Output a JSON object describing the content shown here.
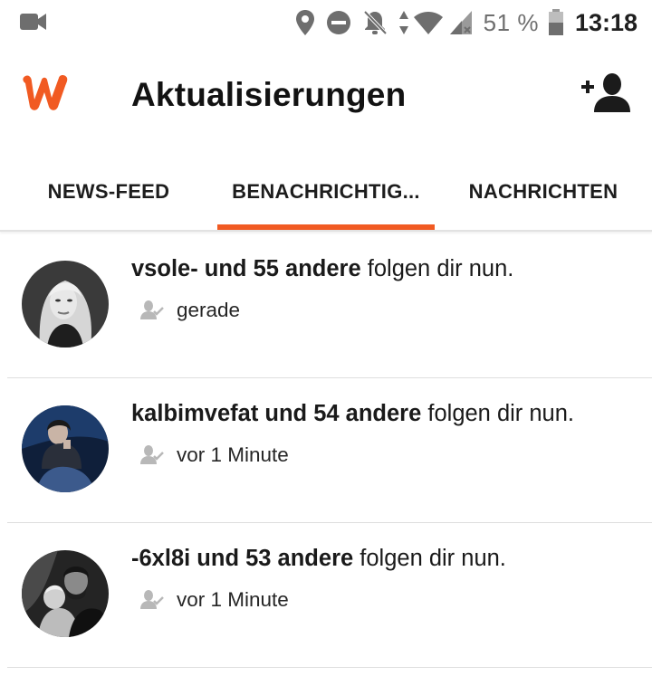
{
  "status_bar": {
    "left_icon": "video-camera-icon",
    "icons": [
      "location-pin-icon",
      "do-not-disturb-icon",
      "notifications-off-icon",
      "data-arrows-icon",
      "wifi-icon",
      "cell-signal-icon",
      "battery-icon"
    ],
    "battery_percent": "51 %",
    "time": "13:18"
  },
  "app_bar": {
    "logo": "wattpad-logo",
    "title": "Aktualisierungen",
    "action_icon": "add-user-icon",
    "brand_color": "#f15a22"
  },
  "tabs": [
    {
      "label": "NEWS-FEED",
      "active": false
    },
    {
      "label": "BENACHRICHTIG...",
      "active": true
    },
    {
      "label": "NACHRICHTEN",
      "active": false
    }
  ],
  "notifications": [
    {
      "user": "vsole- und 55 andere",
      "action": " folgen dir nun.",
      "time": "gerade",
      "meta_icon": "followed-user-icon"
    },
    {
      "user": "kalbimvefat und 54 andere",
      "action": " folgen dir nun.",
      "time": "vor 1 Minute",
      "meta_icon": "followed-user-icon"
    },
    {
      "user": "-6xl8i und 53 andere",
      "action": " folgen dir nun.",
      "time": "vor 1 Minute",
      "meta_icon": "followed-user-icon"
    }
  ]
}
